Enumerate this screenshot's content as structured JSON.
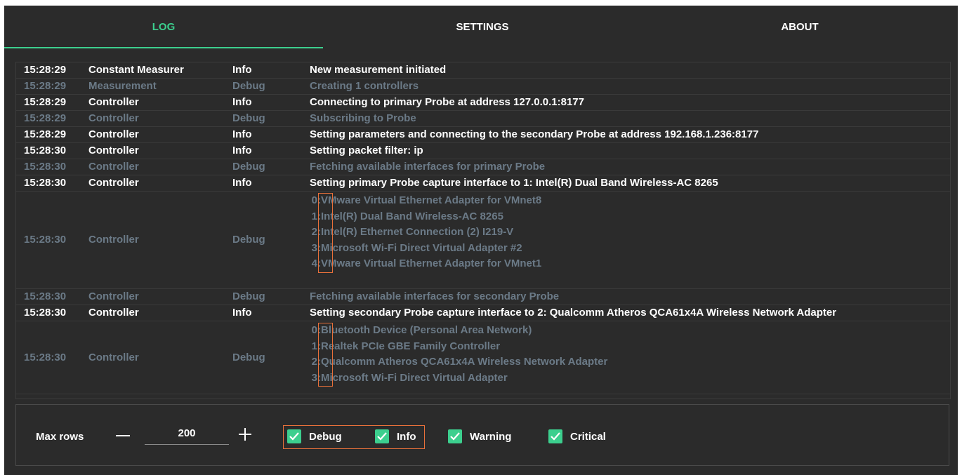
{
  "tabs": [
    {
      "label": "LOG",
      "active": true
    },
    {
      "label": "SETTINGS",
      "active": false
    },
    {
      "label": "ABOUT",
      "active": false
    }
  ],
  "log": {
    "rows": [
      {
        "time": "15:28:29",
        "source": "Constant Measurer",
        "level": "Info",
        "message": "New measurement initiated"
      },
      {
        "time": "15:28:29",
        "source": "Measurement",
        "level": "Debug",
        "message": "Creating 1 controllers"
      },
      {
        "time": "15:28:29",
        "source": "Controller",
        "level": "Info",
        "message": "Connecting to primary Probe at address 127.0.0.1:8177"
      },
      {
        "time": "15:28:29",
        "source": "Controller",
        "level": "Debug",
        "message": "Subscribing to Probe"
      },
      {
        "time": "15:28:29",
        "source": "Controller",
        "level": "Info",
        "message": "Setting parameters and connecting to the secondary Probe at address 192.168.1.236:8177"
      },
      {
        "time": "15:28:30",
        "source": "Controller",
        "level": "Info",
        "message": "Setting packet filter: ip"
      },
      {
        "time": "15:28:30",
        "source": "Controller",
        "level": "Debug",
        "message": "Fetching available interfaces for primary Probe"
      },
      {
        "time": "15:28:30",
        "source": "Controller",
        "level": "Info",
        "message": "Setting primary Probe capture interface to 1: Intel(R) Dual Band Wireless-AC 8265"
      },
      {
        "time": "15:28:30",
        "source": "Controller",
        "level": "Debug",
        "lines": [
          {
            "index": "0:",
            "text": "VMware Virtual Ethernet Adapter for VMnet8"
          },
          {
            "index": "1:",
            "text": "Intel(R) Dual Band Wireless-AC 8265"
          },
          {
            "index": "2:",
            "text": "Intel(R) Ethernet Connection (2) I219-V"
          },
          {
            "index": "3:",
            "text": "Microsoft Wi-Fi Direct Virtual Adapter #2"
          },
          {
            "index": "4:",
            "text": "VMware Virtual Ethernet Adapter for VMnet1"
          }
        ]
      },
      {
        "time": "15:28:30",
        "source": "Controller",
        "level": "Debug",
        "message": "Fetching available interfaces for secondary Probe"
      },
      {
        "time": "15:28:30",
        "source": "Controller",
        "level": "Info",
        "message": "Setting secondary Probe capture interface to 2: Qualcomm Atheros QCA61x4A Wireless Network Adapter"
      },
      {
        "time": "15:28:30",
        "source": "Controller",
        "level": "Debug",
        "lines": [
          {
            "index": "0:",
            "text": "Bluetooth Device (Personal Area Network)"
          },
          {
            "index": "1:",
            "text": "Realtek PCIe GBE Family Controller"
          },
          {
            "index": "2:",
            "text": "Qualcomm Atheros QCA61x4A Wireless Network Adapter"
          },
          {
            "index": "3:",
            "text": "Microsoft Wi-Fi Direct Virtual Adapter"
          }
        ]
      }
    ]
  },
  "controls": {
    "max_rows_label": "Max rows",
    "max_rows_value": "200",
    "filters": [
      {
        "label": "Debug",
        "checked": true
      },
      {
        "label": "Info",
        "checked": true
      },
      {
        "label": "Warning",
        "checked": true
      },
      {
        "label": "Critical",
        "checked": true
      }
    ]
  },
  "colors": {
    "accent": "#3ccf8e",
    "background": "#2b2b2b",
    "info_text": "#ffffff",
    "debug_text": "#6b7a87",
    "highlight": "#e8703a"
  }
}
